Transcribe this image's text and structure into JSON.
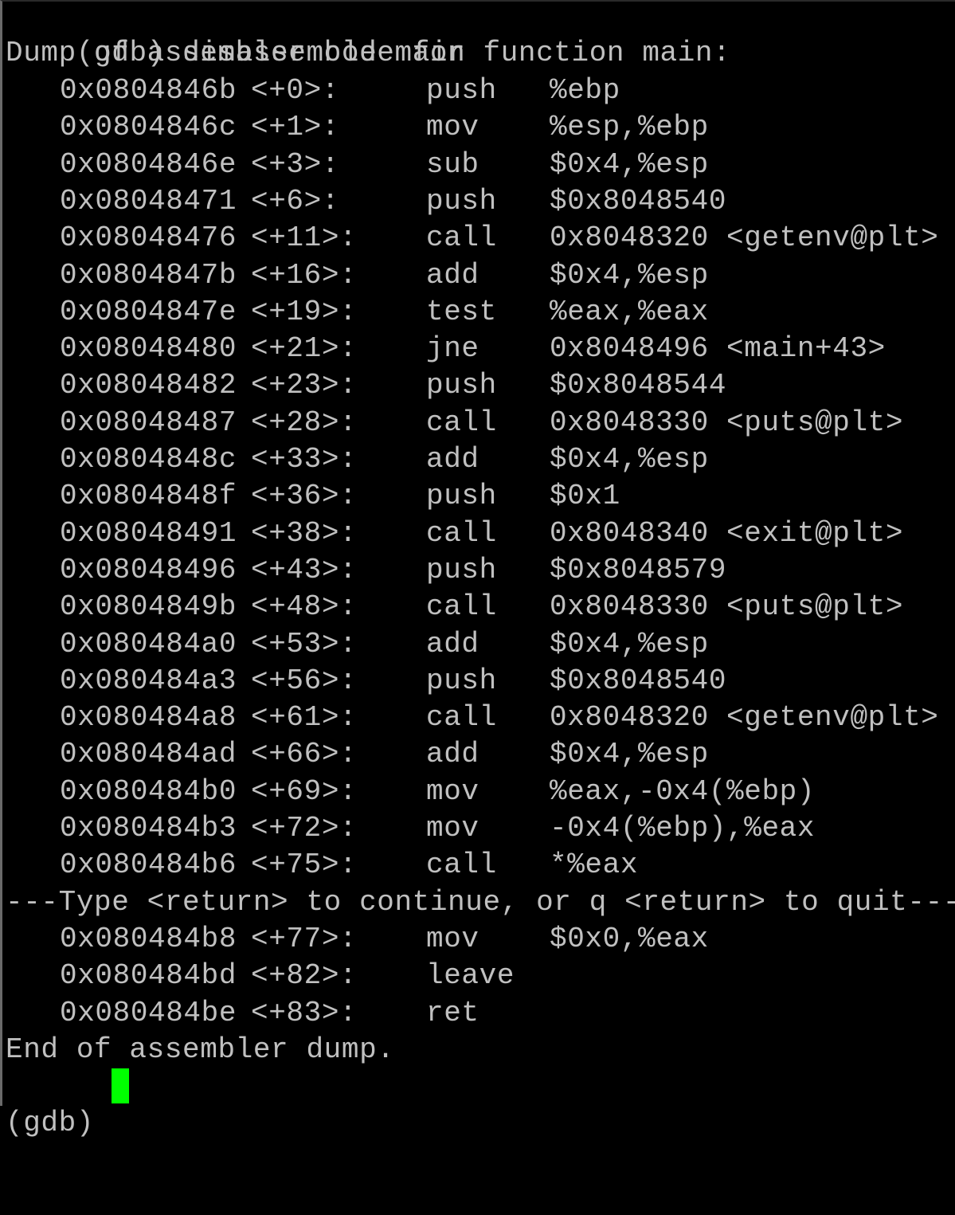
{
  "terminal": {
    "command_prompt": "(gdb)",
    "command": "disassemble main",
    "header": "Dump of assembler code for function main:",
    "instructions": [
      {
        "addr": "0x0804846b",
        "offset": "<+0>:",
        "mnemonic": "push",
        "operands": "%ebp"
      },
      {
        "addr": "0x0804846c",
        "offset": "<+1>:",
        "mnemonic": "mov",
        "operands": "%esp,%ebp"
      },
      {
        "addr": "0x0804846e",
        "offset": "<+3>:",
        "mnemonic": "sub",
        "operands": "$0x4,%esp"
      },
      {
        "addr": "0x08048471",
        "offset": "<+6>:",
        "mnemonic": "push",
        "operands": "$0x8048540"
      },
      {
        "addr": "0x08048476",
        "offset": "<+11>:",
        "mnemonic": "call",
        "operands": "0x8048320 <getenv@plt>"
      },
      {
        "addr": "0x0804847b",
        "offset": "<+16>:",
        "mnemonic": "add",
        "operands": "$0x4,%esp"
      },
      {
        "addr": "0x0804847e",
        "offset": "<+19>:",
        "mnemonic": "test",
        "operands": "%eax,%eax"
      },
      {
        "addr": "0x08048480",
        "offset": "<+21>:",
        "mnemonic": "jne",
        "operands": "0x8048496 <main+43>"
      },
      {
        "addr": "0x08048482",
        "offset": "<+23>:",
        "mnemonic": "push",
        "operands": "$0x8048544"
      },
      {
        "addr": "0x08048487",
        "offset": "<+28>:",
        "mnemonic": "call",
        "operands": "0x8048330 <puts@plt>"
      },
      {
        "addr": "0x0804848c",
        "offset": "<+33>:",
        "mnemonic": "add",
        "operands": "$0x4,%esp"
      },
      {
        "addr": "0x0804848f",
        "offset": "<+36>:",
        "mnemonic": "push",
        "operands": "$0x1"
      },
      {
        "addr": "0x08048491",
        "offset": "<+38>:",
        "mnemonic": "call",
        "operands": "0x8048340 <exit@plt>"
      },
      {
        "addr": "0x08048496",
        "offset": "<+43>:",
        "mnemonic": "push",
        "operands": "$0x8048579"
      },
      {
        "addr": "0x0804849b",
        "offset": "<+48>:",
        "mnemonic": "call",
        "operands": "0x8048330 <puts@plt>"
      },
      {
        "addr": "0x080484a0",
        "offset": "<+53>:",
        "mnemonic": "add",
        "operands": "$0x4,%esp"
      },
      {
        "addr": "0x080484a3",
        "offset": "<+56>:",
        "mnemonic": "push",
        "operands": "$0x8048540"
      },
      {
        "addr": "0x080484a8",
        "offset": "<+61>:",
        "mnemonic": "call",
        "operands": "0x8048320 <getenv@plt>"
      },
      {
        "addr": "0x080484ad",
        "offset": "<+66>:",
        "mnemonic": "add",
        "operands": "$0x4,%esp"
      },
      {
        "addr": "0x080484b0",
        "offset": "<+69>:",
        "mnemonic": "mov",
        "operands": "%eax,-0x4(%ebp)"
      },
      {
        "addr": "0x080484b3",
        "offset": "<+72>:",
        "mnemonic": "mov",
        "operands": "-0x4(%ebp),%eax"
      },
      {
        "addr": "0x080484b6",
        "offset": "<+75>:",
        "mnemonic": "call",
        "operands": "*%eax"
      }
    ],
    "pager_message": "---Type <return> to continue, or q <return> to quit---",
    "instructions_after_pager": [
      {
        "addr": "0x080484b8",
        "offset": "<+77>:",
        "mnemonic": "mov",
        "operands": "$0x0,%eax"
      },
      {
        "addr": "0x080484bd",
        "offset": "<+82>:",
        "mnemonic": "leave",
        "operands": ""
      },
      {
        "addr": "0x080484be",
        "offset": "<+83>:",
        "mnemonic": "ret",
        "operands": ""
      }
    ],
    "footer": "End of assembler dump.",
    "final_prompt": "(gdb)",
    "cursor_color": "#00ff00",
    "text_color": "#c0c0c0",
    "background_color": "#000000"
  }
}
